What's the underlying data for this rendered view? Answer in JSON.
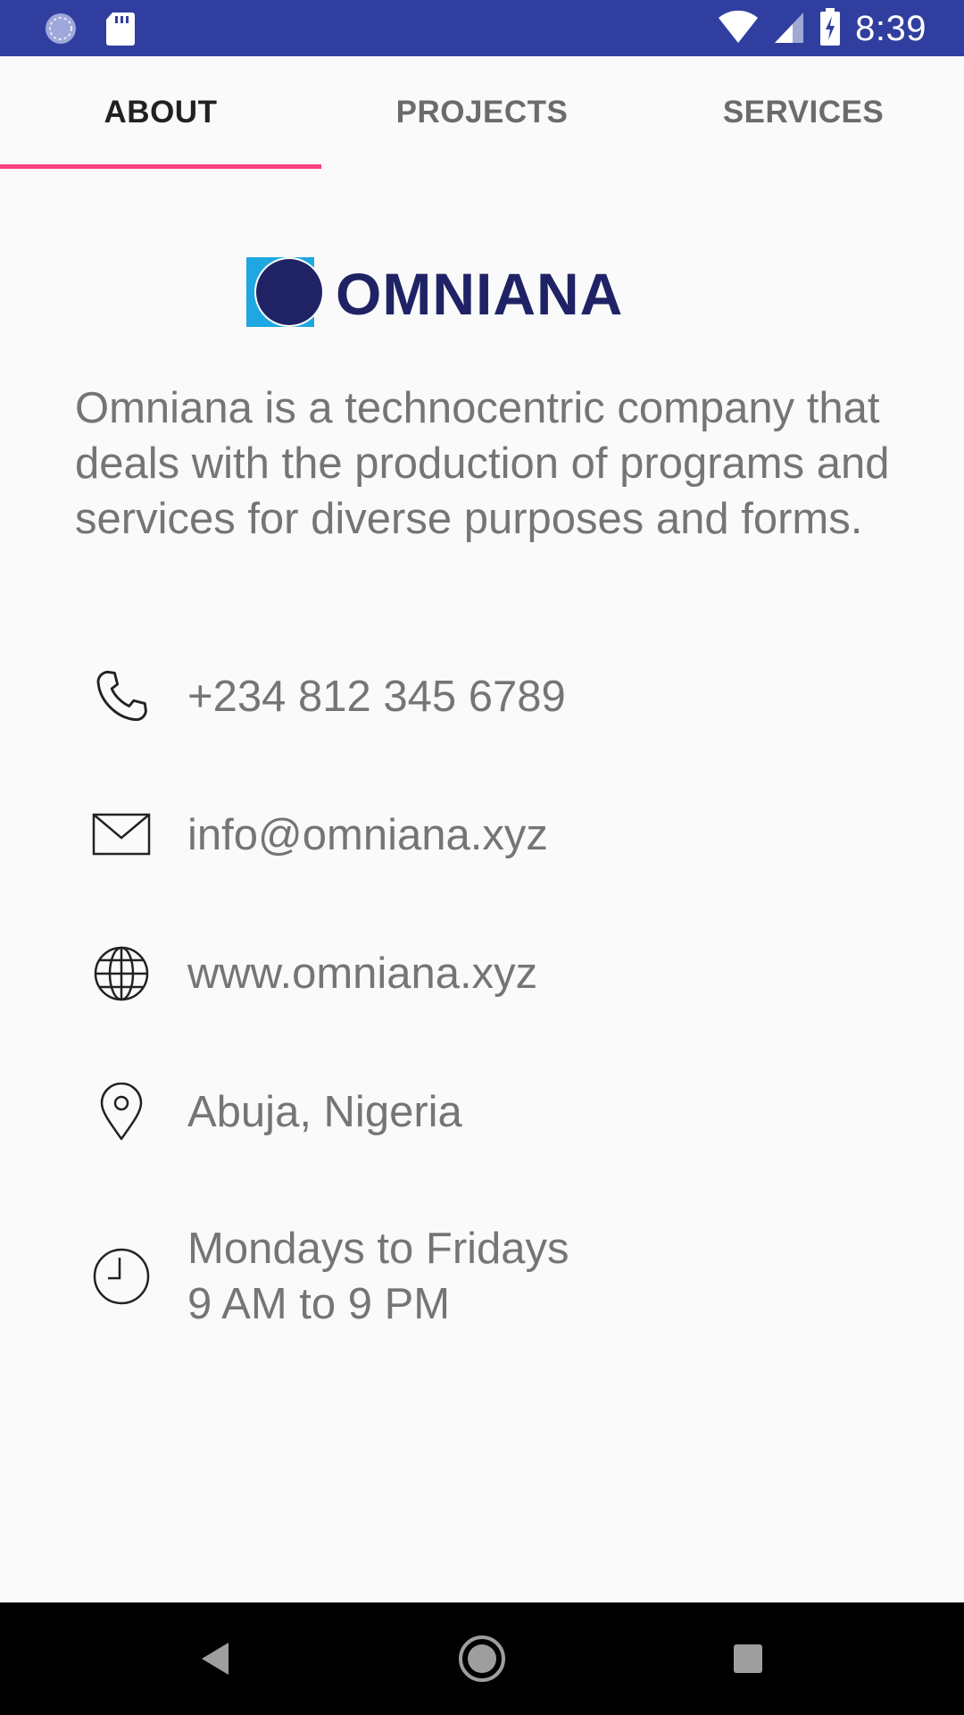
{
  "status_bar": {
    "time": "8:39",
    "icons": [
      "sync-icon",
      "sd-card-icon",
      "wifi-icon",
      "signal-icon",
      "battery-charging-icon"
    ]
  },
  "tabs": [
    {
      "label": "ABOUT",
      "active": true
    },
    {
      "label": "PROJECTS",
      "active": false
    },
    {
      "label": "SERVICES",
      "active": false
    }
  ],
  "logo": {
    "text": "OMNIANA"
  },
  "description": "Omniana is a technocentric company that deals with the production of programs and services for diverse purposes and forms.",
  "contacts": {
    "phone": {
      "icon": "phone-icon",
      "text": "+234 812 345 6789"
    },
    "email": {
      "icon": "mail-icon",
      "text": "info@omniana.xyz"
    },
    "website": {
      "icon": "globe-icon",
      "text": "www.omniana.xyz"
    },
    "location": {
      "icon": "location-pin-icon",
      "text": "Abuja, Nigeria"
    },
    "hours": {
      "icon": "clock-icon",
      "line1": "Mondays to Fridays",
      "line2": "9 AM to 9 PM"
    }
  },
  "nav_bar": {
    "icons": [
      "back-icon",
      "home-icon",
      "recents-icon"
    ]
  },
  "colors": {
    "status_bar": "#303f9f",
    "tab_indicator": "#ff4081",
    "logo_navy": "#1f2366",
    "logo_cyan": "#1ea7e1",
    "body_text": "#757575"
  }
}
